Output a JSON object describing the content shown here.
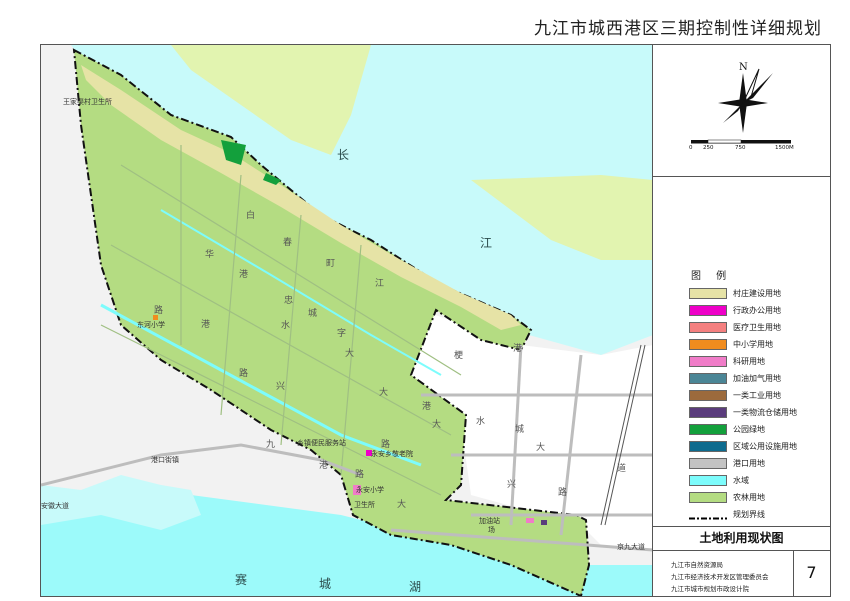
{
  "title": "九江市城西港区三期控制性详细规划",
  "map": {
    "labels": {
      "wangjiaju": "王家渠村卫生所",
      "dongheschool": "东河小学",
      "gangkoustreet": "港口街镇",
      "xiangji": "乡镇便民服务站",
      "yongan_elder": "永安乡敬老院",
      "yongan_school": "永安小学",
      "health": "卫生所",
      "jiayou": "加油站",
      "xiangzhan": "场",
      "bianjie_a": "安徽大道",
      "road_right": "京九大道"
    },
    "road_chars": {
      "baichun": [
        "白",
        "春",
        "町",
        "江"
      ],
      "huagang": [
        "华",
        "港",
        "忠",
        "城"
      ],
      "lugang": [
        "路",
        "港",
        "水",
        "字"
      ],
      "lu_left": [
        "路",
        "路",
        "兴"
      ],
      "daoh": [
        "大",
        "大"
      ],
      "jiu": [
        "九",
        "港",
        "路",
        "大"
      ],
      "bottom": [
        "港",
        "大"
      ],
      "right": [
        "梗",
        "水",
        "城",
        "大",
        "路",
        "兴",
        "道",
        "港"
      ]
    },
    "water": {
      "chang": "长",
      "jiang": "江",
      "sai": "赛",
      "cheng": "城",
      "hu": "湖"
    }
  },
  "compass": {
    "north": "N",
    "scale": [
      "0",
      "250",
      "750",
      "1500M"
    ]
  },
  "legend": {
    "title": "图 例",
    "items": [
      {
        "label": "村庄建设用地",
        "color": "#e6e3a6"
      },
      {
        "label": "行政办公用地",
        "color": "#ee00c8"
      },
      {
        "label": "医疗卫生用地",
        "color": "#f48080"
      },
      {
        "label": "中小学用地",
        "color": "#f08c1e"
      },
      {
        "label": "科研用地",
        "color": "#f07cc8"
      },
      {
        "label": "加油加气用地",
        "color": "#4b8696"
      },
      {
        "label": "一类工业用地",
        "color": "#9c6a3c"
      },
      {
        "label": "一类物流仓储用地",
        "color": "#5a3c7c"
      },
      {
        "label": "公园绿地",
        "color": "#13a03c"
      },
      {
        "label": "区域公用设施用地",
        "color": "#0d6b8e"
      },
      {
        "label": "港口用地",
        "color": "#c3c3c3"
      },
      {
        "label": "水域",
        "color": "#7dfcfc"
      },
      {
        "label": "农林用地",
        "color": "#b4dc82"
      },
      {
        "label": "规划界线",
        "color": "#000000"
      }
    ]
  },
  "map_name": "土地利用现状图",
  "orgs": [
    "九江市自然资源局",
    "九江市经济技术开发区管理委员会",
    "九江市城市规划市政设计院"
  ],
  "page": "7"
}
